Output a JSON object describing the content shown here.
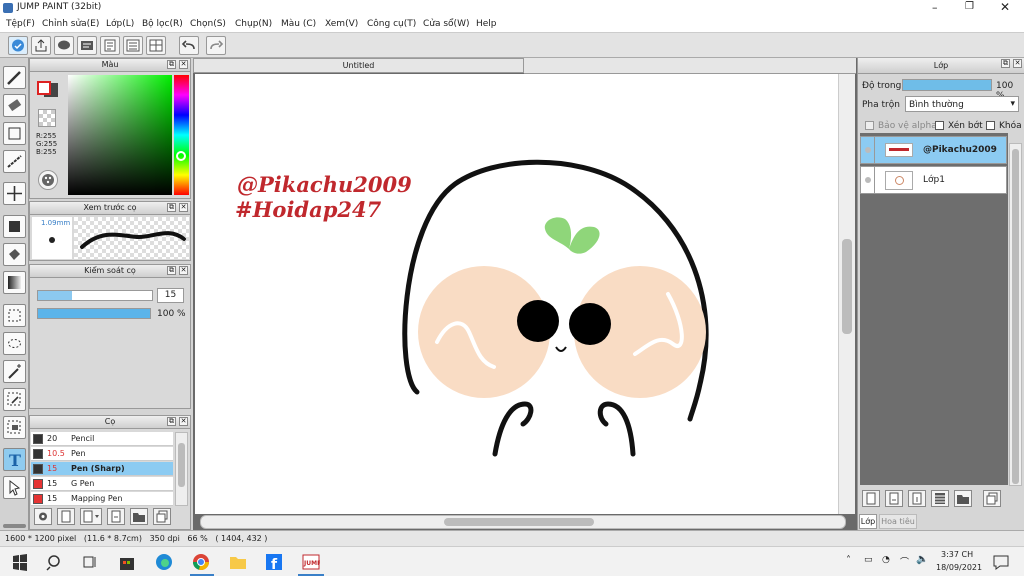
{
  "window": {
    "title": "JUMP PAINT (32bit)"
  },
  "menu": [
    "Tệp(F)",
    "Chỉnh sửa(E)",
    "Lớp(L)",
    "Bộ lọc(R)",
    "Chọn(S)",
    "Chụp(N)",
    "Màu (C)",
    "Xem(V)",
    "Công cụ(T)",
    "Cửa sổ(W)",
    "Help"
  ],
  "color_panel": {
    "title": "Màu",
    "r": "R:255",
    "g": "G:255",
    "b": "B:255",
    "fg": "#ffffff",
    "bg": "#444444"
  },
  "brush_preview": {
    "title": "Xem trước cọ",
    "size": "1.09mm"
  },
  "brush_control": {
    "title": "Kiểm soát cọ",
    "size_value": "15",
    "opacity_value": "100 %"
  },
  "brushes": {
    "title": "Cọ",
    "items": [
      {
        "size": "20",
        "name": "Pencil",
        "color": "#333333",
        "selected": false
      },
      {
        "size": "10.5",
        "name": "Pen",
        "color": "#333333",
        "selected": false
      },
      {
        "size": "15",
        "name": "Pen (Sharp)",
        "color": "#333333",
        "selected": true
      },
      {
        "size": "15",
        "name": "G Pen",
        "color": "#e53333",
        "selected": false
      },
      {
        "size": "15",
        "name": "Mapping Pen",
        "color": "#e53333",
        "selected": false
      }
    ]
  },
  "canvas": {
    "tab_title": "Untitled",
    "text1": "@Pikachu2009",
    "text2": "#Hoidap247",
    "text_color": "#c0282d"
  },
  "layers": {
    "title": "Lớp",
    "opacity_label": "Độ trong",
    "opacity_value": "100 %",
    "blend_label": "Pha trộn",
    "blend_value": "Bình thường",
    "protect_alpha": "Bảo vệ alpha",
    "clipping": "Xén bớt",
    "lock": "Khóa",
    "items": [
      {
        "name": "@Pikachu2009",
        "selected": true
      },
      {
        "name": "Lớp1",
        "selected": false
      }
    ],
    "tabs": [
      "Lớp",
      "Hoa tiêu"
    ]
  },
  "status": {
    "info": "1600 * 1200 pixel   (11.6 * 8.7cm)   350 dpi   66 %   ( 1404, 432 )"
  },
  "taskbar": {
    "time": "3:37 CH",
    "date": "18/09/2021"
  },
  "colors": {
    "accent": "#7ec8f0",
    "skin": "#f9dcc4",
    "sprout": "#8fd67a"
  }
}
